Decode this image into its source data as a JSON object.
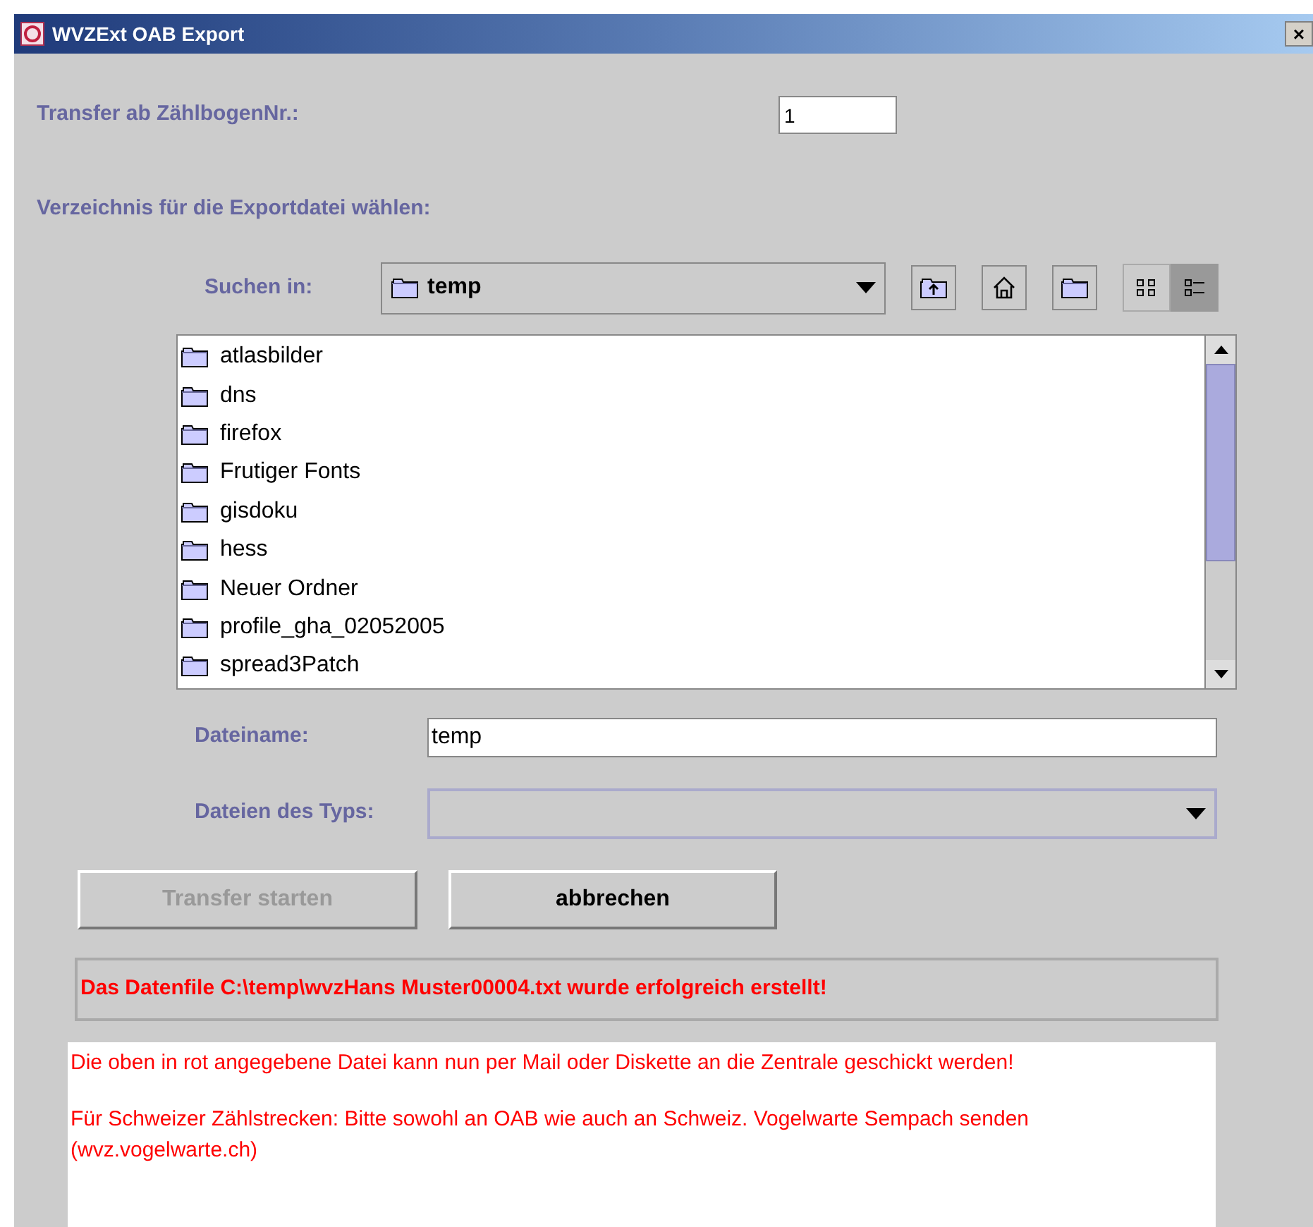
{
  "window": {
    "title": "WVZExt OAB Export",
    "close": "×"
  },
  "start_number": {
    "label": "Transfer ab ZählbogenNr.:",
    "value": "1"
  },
  "directory_label": "Verzeichnis für die Exportdatei wählen:",
  "chooser": {
    "look_in_label": "Suchen in:",
    "look_in_value": "temp",
    "views": [
      {
        "kind": "icons",
        "selected": false
      },
      {
        "kind": "details",
        "selected": true
      }
    ],
    "files": [
      "atlasbilder",
      "dns",
      "firefox",
      "Frutiger Fonts",
      "gisdoku",
      "hess",
      "Neuer Ordner",
      "profile_gha_02052005",
      "spread3Patch"
    ],
    "file_name_label": "Dateiname:",
    "file_name": "temp",
    "file_type_label": "Dateien des Typs:"
  },
  "buttons": [
    {
      "label": "Transfer starten",
      "disabled": true
    },
    {
      "label": "abbrechen",
      "disabled": false
    }
  ],
  "status": "Das Datenfile C:\\temp\\wvzHans Muster00004.txt wurde erfolgreich erstellt!",
  "notes": [
    "Die oben in rot angegebene Datei kann nun per Mail oder Diskette an die Zentrale geschickt werden!",
    "Für Schweizer Zählstrecken: Bitte sowohl an OAB wie auch an Schweiz. Vogelwarte Sempach senden (wvz.vogelwarte.ch)"
  ]
}
